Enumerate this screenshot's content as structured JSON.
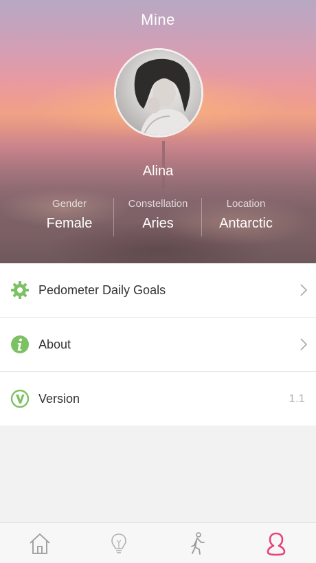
{
  "header": {
    "title": "Mine"
  },
  "profile": {
    "name": "Alina",
    "stats": [
      {
        "label": "Gender",
        "value": "Female"
      },
      {
        "label": "Constellation",
        "value": "Aries"
      },
      {
        "label": "Location",
        "value": "Antarctic"
      }
    ]
  },
  "menu": {
    "items": [
      {
        "label": "Pedometer Daily Goals",
        "icon": "gear-icon"
      },
      {
        "label": "About",
        "icon": "info-icon"
      },
      {
        "label": "Version",
        "icon": "v-logo-icon",
        "value": "1.1"
      }
    ]
  },
  "tabbar": {
    "tabs": [
      {
        "icon": "home-icon"
      },
      {
        "icon": "lightbulb-icon"
      },
      {
        "icon": "walking-icon"
      },
      {
        "icon": "profile-icon",
        "active": true
      }
    ]
  },
  "colors": {
    "accent_green": "#7cc163",
    "active_tab": "#e8427c",
    "inactive_tab": "#9a9a9a"
  }
}
